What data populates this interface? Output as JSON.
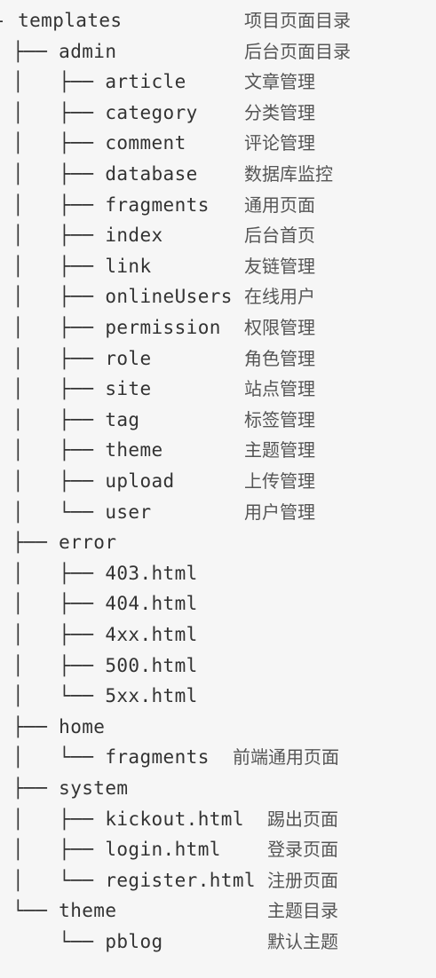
{
  "lines": [
    {
      "text": "- templates",
      "desc": "项目页面目录"
    },
    {
      "text": "├── admin",
      "desc": "后台页面目录"
    },
    {
      "text": "│   ├── article",
      "desc": "文章管理"
    },
    {
      "text": "│   ├── category",
      "desc": "分类管理"
    },
    {
      "text": "│   ├── comment",
      "desc": "评论管理"
    },
    {
      "text": "│   ├── database",
      "desc": "数据库监控"
    },
    {
      "text": "│   ├── fragments",
      "desc": "通用页面"
    },
    {
      "text": "│   ├── index",
      "desc": "后台首页"
    },
    {
      "text": "│   ├── link",
      "desc": "友链管理"
    },
    {
      "text": "│   ├── onlineUsers",
      "desc": "在线用户"
    },
    {
      "text": "│   ├── permission",
      "desc": "权限管理"
    },
    {
      "text": "│   ├── role",
      "desc": "角色管理"
    },
    {
      "text": "│   ├── site",
      "desc": "站点管理"
    },
    {
      "text": "│   ├── tag",
      "desc": "标签管理"
    },
    {
      "text": "│   ├── theme",
      "desc": "主题管理"
    },
    {
      "text": "│   ├── upload",
      "desc": "上传管理"
    },
    {
      "text": "│   └── user",
      "desc": "用户管理"
    },
    {
      "text": "├── error",
      "desc": ""
    },
    {
      "text": "│   ├── 403.html",
      "desc": ""
    },
    {
      "text": "│   ├── 404.html",
      "desc": ""
    },
    {
      "text": "│   ├── 4xx.html",
      "desc": ""
    },
    {
      "text": "│   ├── 500.html",
      "desc": ""
    },
    {
      "text": "│   └── 5xx.html",
      "desc": ""
    },
    {
      "text": "├── home",
      "desc": ""
    },
    {
      "text": "│   └── fragments",
      "desc": "前端通用页面"
    },
    {
      "text": "├── system",
      "desc": ""
    },
    {
      "text": "│   ├── kickout.html",
      "desc": "踢出页面"
    },
    {
      "text": "│   ├── login.html",
      "desc": "登录页面"
    },
    {
      "text": "│   └── register.html",
      "desc": "注册页面"
    },
    {
      "text": "└── theme",
      "desc": "主题目录"
    },
    {
      "text": "    └── pblog",
      "desc": "默认主题"
    }
  ]
}
